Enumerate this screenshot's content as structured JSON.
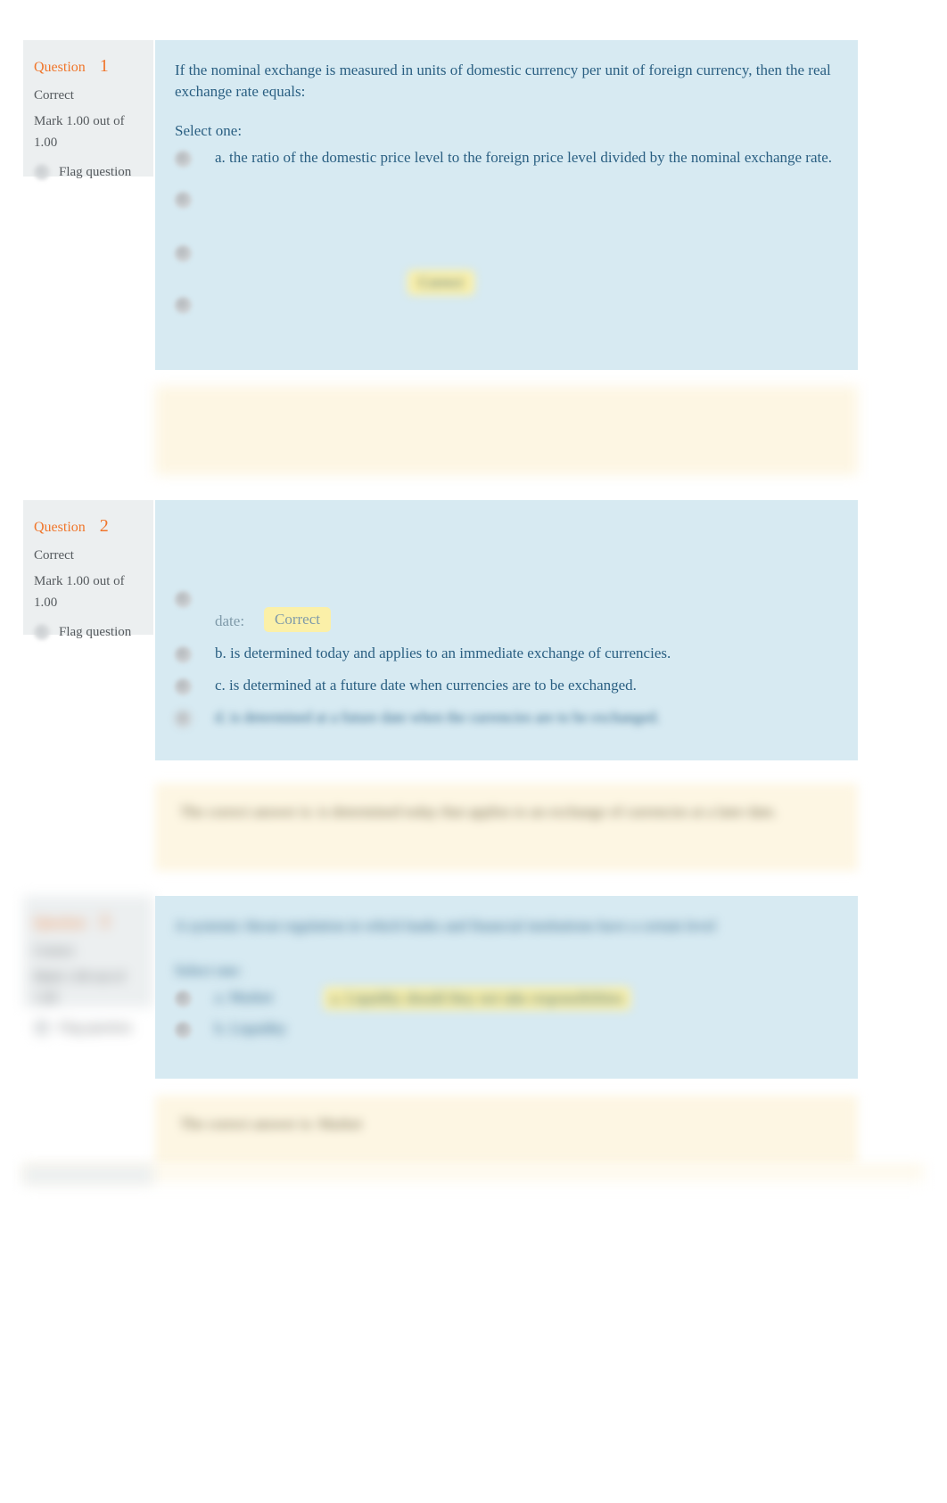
{
  "page": {
    "background": "#ffffff",
    "panel_color": "#d7eaf2",
    "info_color": "#eceff0",
    "feedback_color": "#fdf6e3",
    "accent_color": "#f0762b",
    "text_color": "#2a5f82",
    "highlight_color": "#fbf0a8"
  },
  "questions": [
    {
      "id": "q1",
      "info": {
        "label": "Question",
        "number": "1",
        "state": "Correct",
        "mark": "Mark 1.00 out of 1.00",
        "flag": "Flag question"
      },
      "stem": "If the nominal exchange is measured in units of domestic currency per unit of foreign currency, then the real exchange rate equals:",
      "select_prompt": "Select one:",
      "options": [
        {
          "key": "a",
          "text": "a. the ratio of the domestic price level to the foreign price level divided by the nominal exchange rate.",
          "visible": true,
          "blur": "none",
          "badge": ""
        },
        {
          "key": "b",
          "text": "",
          "visible": false,
          "blur": "b3",
          "badge": ""
        },
        {
          "key": "c",
          "text": "",
          "visible": false,
          "blur": "b3",
          "badge": "Correct"
        },
        {
          "key": "d",
          "text": "",
          "visible": false,
          "blur": "b3",
          "badge": ""
        }
      ],
      "feedback": ""
    },
    {
      "id": "q2",
      "info": {
        "label": "Question",
        "number": "2",
        "state": "Correct",
        "mark": "Mark 1.00 out of 1.00",
        "flag": "Flag question"
      },
      "stem": "",
      "select_prompt": "",
      "options": [
        {
          "key": "a",
          "text": "date:",
          "visible": true,
          "blur": "partial",
          "badge": "Correct"
        },
        {
          "key": "b",
          "text": "b. is determined today and applies to an immediate exchange of currencies.",
          "visible": true,
          "blur": "none",
          "badge": ""
        },
        {
          "key": "c",
          "text": "c. is determined at a future date when currencies are to be exchanged.",
          "visible": true,
          "blur": "none",
          "badge": ""
        },
        {
          "key": "d",
          "text": "d. is determined at a future date when the currencies are to be exchanged.",
          "visible": true,
          "blur": "b2",
          "badge": ""
        }
      ],
      "feedback": "The correct answer is: is determined today that applies to an exchange of currencies at a later date."
    },
    {
      "id": "q3",
      "info": {
        "label": "Question",
        "number": "3",
        "state": "Correct",
        "mark": "Mark 1.00 out of 1.00",
        "flag": "Flag question"
      },
      "stem": "A systemic threat regulation in which banks and financial institutions have a certain level",
      "select_prompt": "Select one:",
      "options": [
        {
          "key": "a",
          "text": "a. Market",
          "visible": true,
          "blur": "b2",
          "badge": "a. Liquidity should they not take responsibilities"
        },
        {
          "key": "b",
          "text": "b. Liquidity",
          "visible": true,
          "blur": "b2",
          "badge": ""
        }
      ],
      "feedback": "The correct answer is: Market"
    }
  ]
}
